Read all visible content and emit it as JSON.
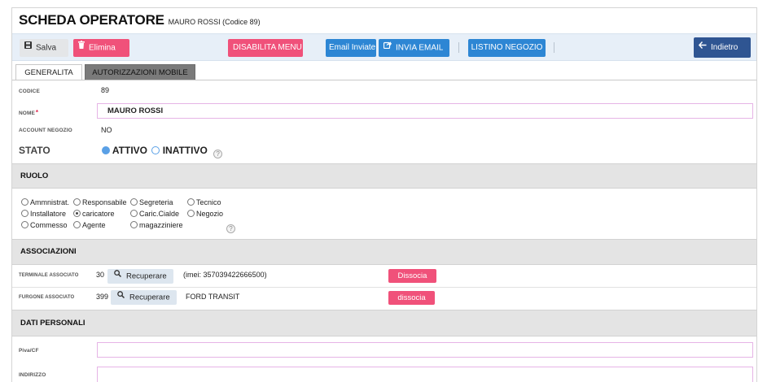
{
  "header": {
    "title": "SCHEDA OPERATORE",
    "subtitle": "MAURO ROSSI (Codice 89)"
  },
  "toolbar": {
    "save_label": "Salva",
    "delete_label": "Elimina",
    "disable_menu_label": "DISABILITA MENU",
    "email_sent_label": "Email Inviate",
    "send_email_label": "INVIA EMAIL",
    "store_list_label": "LISTINO NEGOZIO",
    "back_label": "Indietro"
  },
  "tabs": [
    {
      "label": "GENERALITA",
      "active": true
    },
    {
      "label": "AUTORIZZAZIONI MOBILE",
      "active": false
    }
  ],
  "general": {
    "code_label": "CODICE",
    "code_value": "89",
    "name_label": "NOME",
    "name_required": "*",
    "name_value": "MAURO ROSSI",
    "store_account_label": "ACCOUNT NEGOZIO",
    "store_account_value": "NO",
    "status_label": "STATO",
    "status_active": "ATTIVO",
    "status_inactive": "INATTIVO",
    "status_selected": "ATTIVO",
    "help": "?"
  },
  "role_section": {
    "title": "RUOLO",
    "roles": [
      {
        "label": "Ammnistrat.",
        "selected": false
      },
      {
        "label": "Responsabile",
        "selected": false
      },
      {
        "label": "Segreteria",
        "selected": false
      },
      {
        "label": "Tecnico",
        "selected": false
      },
      {
        "label": "Installatore",
        "selected": false
      },
      {
        "label": "caricatore",
        "selected": true
      },
      {
        "label": "Caric.Cialde",
        "selected": false
      },
      {
        "label": "Negozio",
        "selected": false
      },
      {
        "label": "Commesso",
        "selected": false
      },
      {
        "label": "Agente",
        "selected": false
      },
      {
        "label": "magazziniere",
        "selected": false
      }
    ],
    "help": "?"
  },
  "associations": {
    "title": "ASSOCIAZIONI",
    "terminal_label": "TERMINALE ASSOCIATO",
    "terminal_id": "30",
    "terminal_search_label": "Recuperare",
    "terminal_info": "(imei: 357039422666500)",
    "terminal_dissociate_label": "Dissocia",
    "van_label": "FURGONE ASSOCIATO",
    "van_id": "399",
    "van_search_label": "Recuperare",
    "van_info": "FORD TRANSIT",
    "van_dissociate_label": "dissocia"
  },
  "personal": {
    "title": "DATI PERSONALI",
    "vat_label": "Piva/CF",
    "vat_value": "",
    "address_label": "INDIRIZZO",
    "address_value": ""
  },
  "colors": {
    "pink": "#f0517a",
    "blue": "#2d86d4",
    "navy": "#2f5592",
    "radio_active": "#5aa0e6"
  }
}
